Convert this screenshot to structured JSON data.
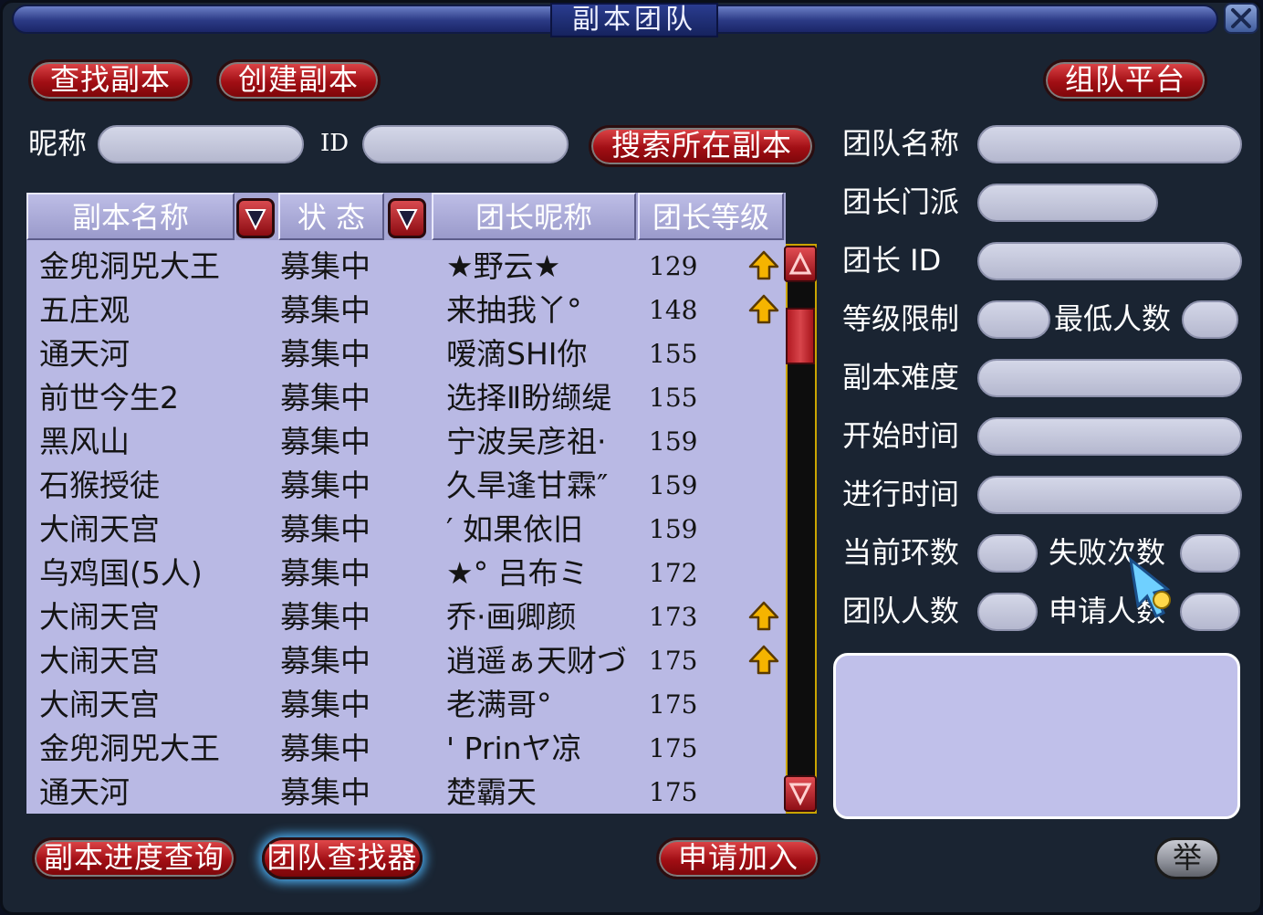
{
  "window": {
    "title": "副本团队",
    "close_label": "X"
  },
  "toolbar": {
    "find_label": "查找副本",
    "create_label": "创建副本",
    "platform_label": "组队平台"
  },
  "search": {
    "nickname_label": "昵称",
    "nickname_value": "",
    "id_label": "ID",
    "id_value": "",
    "search_button": "搜索所在副本"
  },
  "table": {
    "headers": [
      "副本名称",
      "状 态",
      "团长昵称",
      "团长等级"
    ],
    "rows": [
      {
        "name": "金兜洞兕大王",
        "status": "募集中",
        "leader": "★野云★",
        "level": "129",
        "marked": true
      },
      {
        "name": "五庄观",
        "status": "募集中",
        "leader": "来抽我丫°",
        "level": "148",
        "marked": true
      },
      {
        "name": "通天河",
        "status": "募集中",
        "leader": "嗳滴SHI你",
        "level": "155",
        "marked": false
      },
      {
        "name": "前世今生2",
        "status": "募集中",
        "leader": "选择Ⅱ盼缬缇",
        "level": "155",
        "marked": false
      },
      {
        "name": "黑风山",
        "status": "募集中",
        "leader": "宁波吴彦祖·",
        "level": "159",
        "marked": false
      },
      {
        "name": "石猴授徒",
        "status": "募集中",
        "leader": "久旱逢甘霖″",
        "level": "159",
        "marked": false
      },
      {
        "name": "大闹天宫",
        "status": "募集中",
        "leader": "′ 如果依旧",
        "level": "159",
        "marked": false
      },
      {
        "name": "乌鸡国(5人)",
        "status": "募集中",
        "leader": "★° 吕布ミ",
        "level": "172",
        "marked": false
      },
      {
        "name": "大闹天宫",
        "status": "募集中",
        "leader": "乔·画卿颜",
        "level": "173",
        "marked": true
      },
      {
        "name": "大闹天宫",
        "status": "募集中",
        "leader": "逍遥ぁ天财づ",
        "level": "175",
        "marked": true
      },
      {
        "name": "大闹天宫",
        "status": "募集中",
        "leader": "老满哥°",
        "level": "175",
        "marked": false
      },
      {
        "name": "金兜洞兕大王",
        "status": "募集中",
        "leader": "' Prinヤ凉",
        "level": "175",
        "marked": false
      },
      {
        "name": "通天河",
        "status": "募集中",
        "leader": "楚霸天",
        "level": "175",
        "marked": false
      }
    ]
  },
  "details": {
    "team_name": "团队名称",
    "leader_school": "团长门派",
    "leader_id": "团长  ID",
    "level_limit": "等级限制",
    "min_members": "最低人数",
    "difficulty": "副本难度",
    "start_time": "开始时间",
    "elapsed_time": "进行时间",
    "current_round": "当前环数",
    "fail_count": "失败次数",
    "team_size": "团队人数",
    "applicants": "申请人数"
  },
  "footer": {
    "progress_label": "副本进度查询",
    "finder_label": "团队查找器",
    "apply_label": "申请加入",
    "report_label": "举"
  },
  "colors": {
    "button_red": "#a10e14",
    "list_bg": "#b9b9e4",
    "panel_bg": "#1a2432",
    "title_blue": "#2b3a85",
    "scroll_border": "#c9a400"
  }
}
